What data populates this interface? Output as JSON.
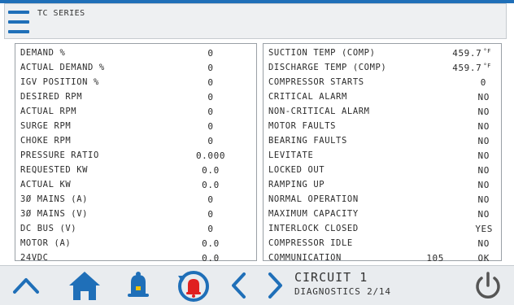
{
  "colors": {
    "accent": "#1f6fb8",
    "alarm": "#e02020",
    "header_bg": "#eef0f2"
  },
  "header": {
    "title": "TC SERIES",
    "menu_icon": "hamburger-menu-icon"
  },
  "left_panel": [
    {
      "label": "DEMAND %",
      "value": "0"
    },
    {
      "label": "ACTUAL DEMAND %",
      "value": "0"
    },
    {
      "label": "IGV POSITION %",
      "value": "0"
    },
    {
      "label": "DESIRED RPM",
      "value": "0"
    },
    {
      "label": "ACTUAL RPM",
      "value": "0"
    },
    {
      "label": "SURGE RPM",
      "value": "0"
    },
    {
      "label": "CHOKE RPM",
      "value": "0"
    },
    {
      "label": "PRESSURE RATIO",
      "value": "0.000"
    },
    {
      "label": "REQUESTED KW",
      "value": "0.0"
    },
    {
      "label": "ACTUAL KW",
      "value": "0.0"
    },
    {
      "label": "3Ø  MAINS (A)",
      "value": "0"
    },
    {
      "label": "3Ø  MAINS (V)",
      "value": "0"
    },
    {
      "label": "DC BUS (V)",
      "value": "0"
    },
    {
      "label": "MOTOR (A)",
      "value": "0.0"
    },
    {
      "label": "24VDC",
      "value": "0.0"
    }
  ],
  "right_panel": [
    {
      "label": "SUCTION TEMP (COMP)",
      "value": "459.7",
      "unit": "°F"
    },
    {
      "label": "DISCHARGE TEMP (COMP)",
      "value": "459.7",
      "unit": "°F"
    },
    {
      "label": "COMPRESSOR STARTS",
      "value": "0"
    },
    {
      "label": "CRITICAL ALARM",
      "value": "NO"
    },
    {
      "label": "NON-CRITICAL ALARM",
      "value": "NO"
    },
    {
      "label": "MOTOR FAULTS",
      "value": "NO"
    },
    {
      "label": "BEARING FAULTS",
      "value": "NO"
    },
    {
      "label": "LEVITATE",
      "value": "NO"
    },
    {
      "label": "LOCKED OUT",
      "value": "NO"
    },
    {
      "label": "RAMPING UP",
      "value": "NO"
    },
    {
      "label": "NORMAL OPERATION",
      "value": "NO"
    },
    {
      "label": "MAXIMUM CAPACITY",
      "value": "NO"
    },
    {
      "label": "INTERLOCK CLOSED",
      "value": "YES"
    },
    {
      "label": "COMPRESSOR IDLE",
      "value": "NO"
    },
    {
      "label": "COMMUNICATION",
      "value": "OK",
      "extra": "105"
    }
  ],
  "footer": {
    "circuit_title": "CIRCUIT 1",
    "page_label": "DIAGNOSTICS 2/14",
    "icons": [
      "chevron-up-icon",
      "home-icon",
      "bell-icon",
      "alarm-reset-icon",
      "chevron-left-icon",
      "chevron-right-icon",
      "power-icon"
    ]
  }
}
